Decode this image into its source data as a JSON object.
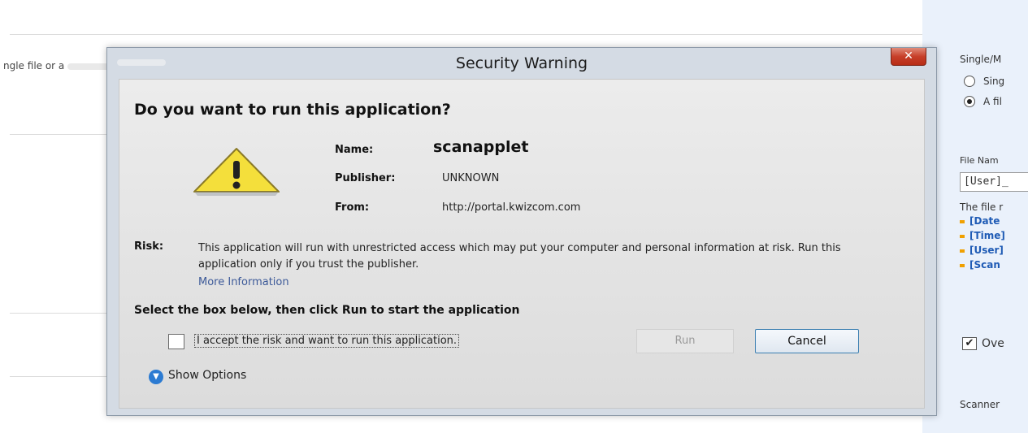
{
  "background": {
    "left_text": "ngle file or a",
    "right_panel": {
      "heading": "Single/M",
      "radio_1": "Sing",
      "radio_2": "A fil",
      "file_name_label": "File Nam",
      "file_name_value": "[User]_",
      "file_desc": "The file r",
      "tokens": [
        "[Date",
        "[Time]",
        "[User]",
        "[Scan"
      ],
      "overwrite": "Ove",
      "scanner": "Scanner"
    }
  },
  "dialog": {
    "title": "Security Warning",
    "close_glyph": "✕",
    "question": "Do you want to run this application?",
    "name_label": "Name:",
    "name_value": "scanapplet",
    "publisher_label": "Publisher:",
    "publisher_value": "UNKNOWN",
    "from_label": "From:",
    "from_value": "http://portal.kwizcom.com",
    "risk_label": "Risk:",
    "risk_text": "This application will run with unrestricted access which may put your computer and personal information at risk. Run this application only if you trust the publisher.",
    "more_info": "More Information",
    "select_box_text": "Select the box below, then click Run to start the application",
    "accept_text": "I accept the risk and want to run this application.",
    "run_label": "Run",
    "cancel_label": "Cancel",
    "show_options": "Show Options",
    "accent": "#2c7bd2"
  }
}
